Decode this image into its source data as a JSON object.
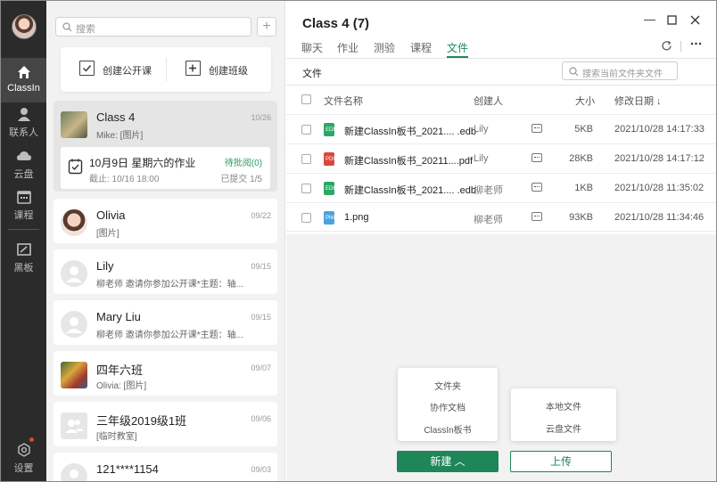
{
  "rail": {
    "items": [
      {
        "label": "ClassIn",
        "icon": "home-icon"
      },
      {
        "label": "联系人",
        "icon": "contacts-icon"
      },
      {
        "label": "云盘",
        "icon": "cloud-icon"
      },
      {
        "label": "课程",
        "icon": "calendar-icon"
      },
      {
        "label": "黑板",
        "icon": "blackboard-icon"
      }
    ],
    "settings_label": "设置"
  },
  "list": {
    "search_placeholder": "搜索",
    "create_open_class": "创建公开课",
    "create_class": "创建班级",
    "conversations": [
      {
        "name": "Class 4",
        "sub": "Mike: [图片]",
        "date": "10/26"
      },
      {
        "name": "Olivia",
        "sub": "[图片]",
        "date": "09/22"
      },
      {
        "name": "Lily",
        "sub": "柳老师 邀请你参加公开课*主题：轴...",
        "date": "09/15"
      },
      {
        "name": "Mary Liu",
        "sub": "柳老师 邀请你参加公开课*主题：轴...",
        "date": "09/15"
      },
      {
        "name": "四年六班",
        "sub": "Olivia: [图片]",
        "date": "09/07"
      },
      {
        "name": "三年级2019级1班",
        "sub": "[临时教室]",
        "date": "09/06"
      },
      {
        "name": "121****1154",
        "sub": "",
        "date": "09/03"
      }
    ],
    "homework": {
      "title": "10月9日 星期六的作业",
      "deadline": "截止: 10/16 18:00",
      "status": "待批阅(0)",
      "submitted": "已提交 1/5"
    }
  },
  "main": {
    "title": "Class 4 (7)",
    "tabs": [
      "聊天",
      "作业",
      "测验",
      "课程",
      "文件"
    ],
    "active_tab": "文件",
    "breadcrumb": "文件",
    "file_search_placeholder": "搜索当前文件夹文件",
    "columns": {
      "name": "文件名称",
      "creator": "创建人",
      "size": "大小",
      "date": "修改日期 ↓"
    },
    "files": [
      {
        "name": "新建ClassIn板书_2021.... .edb",
        "creator": "Lily",
        "size": "5KB",
        "date": "2021/10/28 14:17:33",
        "type": "edb",
        "badge": "EDB"
      },
      {
        "name": "新建ClassIn板书_20211....pdf",
        "creator": "Lily",
        "size": "28KB",
        "date": "2021/10/28 14:17:12",
        "type": "pdf",
        "badge": "PDF"
      },
      {
        "name": "新建ClassIn板书_2021.... .edb",
        "creator": "柳老师",
        "size": "1KB",
        "date": "2021/10/28 11:35:02",
        "type": "edb",
        "badge": "EDB"
      },
      {
        "name": "1.png",
        "creator": "柳老师",
        "size": "93KB",
        "date": "2021/10/28 11:34:46",
        "type": "png",
        "badge": "PNG"
      }
    ],
    "new_menu": [
      "文件夹",
      "协作文档",
      "ClassIn板书"
    ],
    "upload_menu": [
      "本地文件",
      "云盘文件"
    ],
    "new_button": "新建 ︿",
    "upload_button": "上传"
  },
  "colors": {
    "accent": "#1e8659",
    "rail": "#2b2b2b",
    "edb": "#2aa865",
    "pdf": "#d9473b",
    "png": "#4aa3df"
  }
}
